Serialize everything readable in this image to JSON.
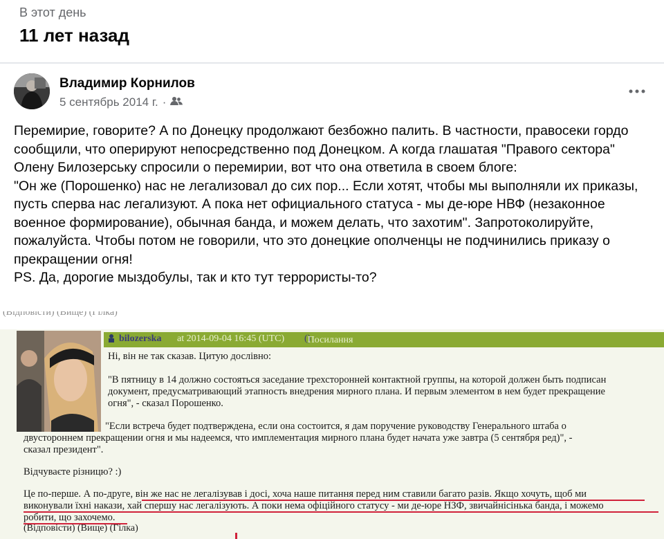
{
  "memory": {
    "label": "В этот день",
    "title": "11 лет назад"
  },
  "post": {
    "author": "Владимир Корнилов",
    "date": "5 сентябрь 2014 г.",
    "date_separator": "·",
    "privacy_icon": "friends-icon",
    "more_icon": "more-horizontal-icon",
    "text": "Перемирие, говорите? А по Донецку продолжают безбожно палить. В частности, правосеки гордо сообщили, что оперируют непосредственно под Донецком. А когда глашатая \"Правого сектора\" Олену Билозерську спросили о перемирии, вот что она ответила в своем блоге:\n\"Он же (Порошенко) нас не легализовал до сих пор... Если хотят, чтобы мы выполняли их приказы, пусть сперва нас легализуют. А пока нет официального статуса - мы де-юре НВФ (незаконное военное формирование), обычная банда, и можем делать, что захотим\". Запротоколируйте, пожалуйста. Чтобы потом не говорили, что это донецкие ополченцы не подчинились приказу о прекращении огня!\nPS. Да, дорогие мыздобулы, так и кто тут террористы-то?"
  },
  "embed": {
    "top_links": "(Відповісти) (Вище) (Гілка)",
    "username": "bilozerska",
    "timestamp": "at 2014-09-04 16:45 (UTC)",
    "link_label": "Посилання",
    "lines": {
      "l1": "Ні, він не так сказав. Цитую дослівно:",
      "q1a": "\"В пятницу в 14 должно состояться заседание трехсторонней контактной группы, на которой должен быть подписан",
      "q1b": "документ, предусматривающий этапность внедрения мирного плана. И первым элементом в нем будет прекращение",
      "q1c": "огня\", - сказал Порошенко.",
      "q2a": "\"Если встреча будет подтверждена, если она состоится, я дам поручение руководству Генерального штаба о",
      "q2b": "двустороннем прекращении огня и мы надеемся, что имплементация мирного плана будет начата уже завтра (5 сентября ред)\", -",
      "q2c": "сказал президент\".",
      "diff": "Відчуваєте різницю? :)",
      "p1": "Це по-перше. А по-друге, він же нас не легалізував і досі, хоча наше питання перед ним ставили багато разів. Якщо хочуть, щоб ми",
      "p2": "виконували їхні накази, хай спершу нас легалізують. А поки нема офіційного статусу - ми де-юре НЗФ, звичайнісінька банда, і можемо",
      "p3": "робити, що захочемо."
    },
    "bottom_links": "(Відповісти) (Вище) (Гілка)",
    "colors": {
      "header_bar": "#8aaa33",
      "underline": "#d0213a",
      "background": "#f4f6ec"
    }
  }
}
